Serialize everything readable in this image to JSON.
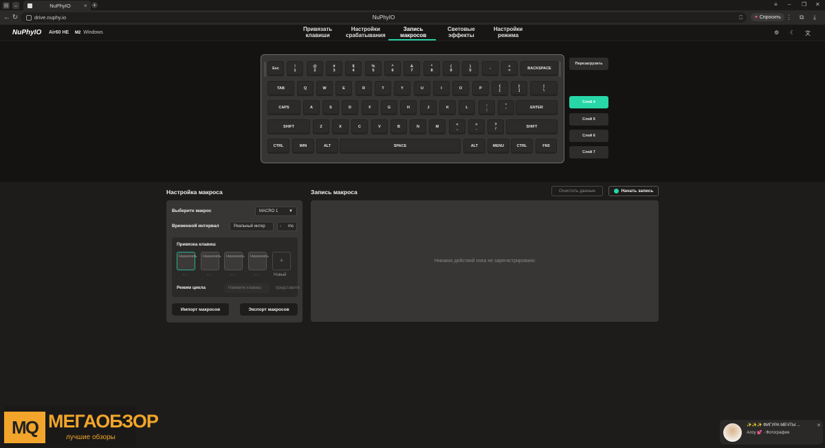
{
  "browser": {
    "tab_title": "NuPhyIO",
    "url": "drive.nuphy.io",
    "page_title": "NuPhyIO",
    "ask_label": "Спросить"
  },
  "app": {
    "logo": "NuPhyIO",
    "model": "Air60 HE",
    "mode_badge": "M2",
    "os": "Windows",
    "nav": [
      {
        "line1": "Привязать",
        "line2": "клавиши"
      },
      {
        "line1": "Настройки",
        "line2": "срабатывания"
      },
      {
        "line1": "Запись",
        "line2": "макросов"
      },
      {
        "line1": "Световые",
        "line2": "эффекты"
      },
      {
        "line1": "Настройки",
        "line2": "режима"
      }
    ],
    "active_nav": "Запись макросов"
  },
  "keyboard": {
    "rows": [
      [
        "Esc",
        "!\n1",
        "@\n2",
        "#\n3",
        "$\n4",
        "%\n5",
        "^\n6",
        "&\n7",
        "*\n8",
        "(\n9",
        ")\n0",
        "-",
        "+\n=",
        "BACKSPACE"
      ],
      [
        "TAB",
        "Q",
        "W",
        "E",
        "R",
        "T",
        "Y",
        "U",
        "I",
        "O",
        "P",
        "{\n[",
        "}\n]",
        "|\n\\"
      ],
      [
        "CAPS",
        "A",
        "S",
        "D",
        "F",
        "G",
        "H",
        "J",
        "K",
        "L",
        ":\n;",
        "\"\n'",
        "ENTER"
      ],
      [
        "SHIFT",
        "Z",
        "X",
        "C",
        "V",
        "B",
        "N",
        "M",
        "<\n,",
        ">\n.",
        "?\n/",
        "SHIFT"
      ],
      [
        "CTRL",
        "WIN",
        "ALT",
        "SPACE",
        "ALT",
        "MENU",
        "CTRL",
        "FN5"
      ]
    ],
    "reload_label": "Перезагрузить",
    "layers": [
      "Слой 4",
      "Слой 5",
      "Слой 6",
      "Слой 7"
    ],
    "active_layer": "Слой 4"
  },
  "macro": {
    "settings_title": "Настройка макроса",
    "select_label": "Выберите макрос",
    "select_value": "MACRO 1",
    "interval_label": "Временной интервал",
    "interval_value": "Реальный интер",
    "interval_dash": "-",
    "interval_unit": "ms",
    "binding_title": "Привязка клавиш",
    "binding_slots": [
      "Назначать",
      "Назначать",
      "Назначать",
      "Назначать"
    ],
    "binding_placeholder": "- -",
    "new_label": "Новый",
    "loop_label": "Режим цикла",
    "loop_placeholder": "Нажмите клавиш",
    "loop_placeholder2": "представите",
    "import_label": "Импорт макросов",
    "export_label": "Экспорт макросов",
    "record_title": "Запись макроса",
    "clear_label": "Очистить данные",
    "start_label": "Начать запись",
    "empty_message": "Никаких действий пока не зарегистрировано"
  },
  "watermark": {
    "mark": "MQ",
    "title": "МЕГАОБЗОР",
    "subtitle": "лучшие обзоры"
  },
  "notification": {
    "line1": "✨✨✨ ФИГУРА МЕЧТЫ ...",
    "line2": "Алсу 💕 · Фотография"
  },
  "colors": {
    "accent": "#27d7a8",
    "watermark": "#f2a52a"
  }
}
